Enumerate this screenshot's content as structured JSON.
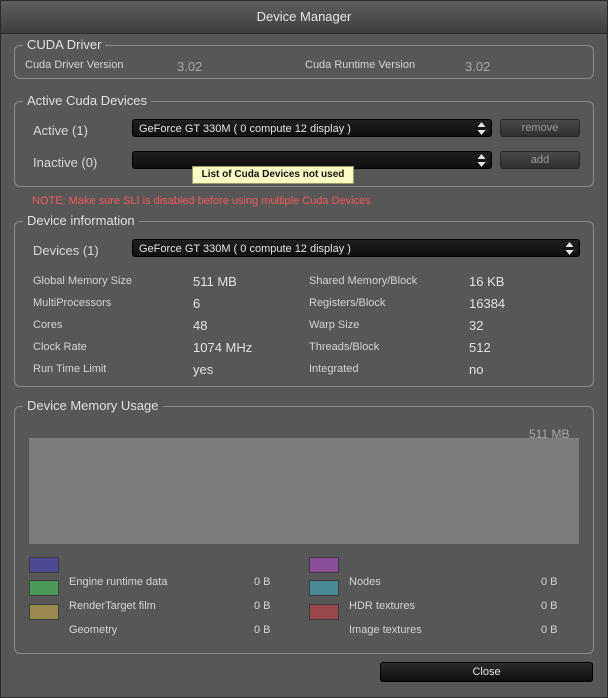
{
  "window": {
    "title": "Device Manager"
  },
  "cuda_driver": {
    "group_title": "CUDA Driver",
    "driver_version_label": "Cuda Driver Version",
    "driver_version": "3.02",
    "runtime_version_label": "Cuda Runtime Version",
    "runtime_version": "3.02"
  },
  "active_devices": {
    "group_title": "Active Cuda Devices",
    "active_label": "Active (1)",
    "active_selected": "GeForce GT 330M ( 0 compute 12 display )",
    "remove_label": "remove",
    "inactive_label": "Inactive (0)",
    "inactive_selected": "",
    "add_label": "add",
    "tooltip": "List of Cuda Devices not used",
    "note": "NOTE: Make sure SLI is disabled before using multiple Cuda Devices"
  },
  "device_info": {
    "group_title": "Device information",
    "devices_label": "Devices (1)",
    "devices_selected": "GeForce GT 330M ( 0 compute 12 display )",
    "left": [
      {
        "label": "Global Memory Size",
        "value": "511 MB"
      },
      {
        "label": "MultiProcessors",
        "value": "6"
      },
      {
        "label": "Cores",
        "value": "48"
      },
      {
        "label": "Clock Rate",
        "value": "1074 MHz"
      },
      {
        "label": "Run Time Limit",
        "value": "yes"
      }
    ],
    "right": [
      {
        "label": "Shared Memory/Block",
        "value": "16 KB"
      },
      {
        "label": "Registers/Block",
        "value": "16384"
      },
      {
        "label": "Warp Size",
        "value": "32"
      },
      {
        "label": "Threads/Block",
        "value": "512"
      },
      {
        "label": "Integrated",
        "value": "no"
      }
    ]
  },
  "memory_usage": {
    "group_title": "Device Memory Usage",
    "total": "511 MB",
    "legend": [
      {
        "name": "Engine runtime data",
        "value": "0 B",
        "color": "#4b4a92"
      },
      {
        "name": "RenderTarget film",
        "value": "0 B",
        "color": "#4c9a5a"
      },
      {
        "name": "Geometry",
        "value": "0 B",
        "color": "#9a8a50"
      },
      {
        "name": "Nodes",
        "value": "0 B",
        "color": "#8a4e9a"
      },
      {
        "name": "HDR textures",
        "value": "0 B",
        "color": "#4a8a96"
      },
      {
        "name": "Image textures",
        "value": "0 B",
        "color": "#984848"
      }
    ]
  },
  "footer": {
    "close_label": "Close"
  }
}
